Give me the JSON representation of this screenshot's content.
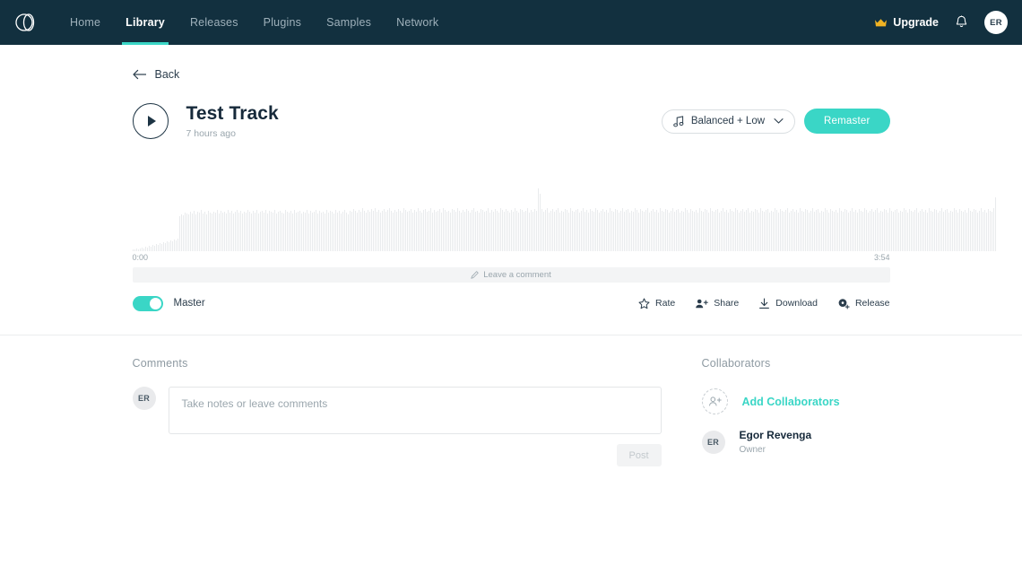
{
  "navbar": {
    "logo_icon": "overlapping-circles-logo",
    "items": [
      {
        "label": "Home",
        "active": false
      },
      {
        "label": "Library",
        "active": true
      },
      {
        "label": "Releases",
        "active": false
      },
      {
        "label": "Plugins",
        "active": false
      },
      {
        "label": "Samples",
        "active": false
      },
      {
        "label": "Network",
        "active": false
      }
    ],
    "upgrade_label": "Upgrade",
    "upgrade_icon": "crown-icon",
    "notification_icon": "bell-icon",
    "avatar_initials": "ER",
    "bg_color": "#12303f",
    "accent_color": "#3ad6c6",
    "crown_color": "#f0b323"
  },
  "page": {
    "back_label": "Back",
    "back_icon": "arrow-left-icon"
  },
  "track": {
    "play_icon": "play-icon",
    "title": "Test Track",
    "subtitle": "7 hours ago",
    "preset_label": "Balanced + Low",
    "preset_icon": "music-note-icon",
    "preset_chevron": "chevron-down-icon",
    "remaster_label": "Remaster",
    "remaster_color": "#3ad6c6"
  },
  "waveform": {
    "start_time": "0:00",
    "end_time": "3:54",
    "bar_color": "#e9ebed",
    "comment_hint": "Leave a comment",
    "comment_hint_icon": "pencil-icon",
    "amplitudes": [
      2,
      2,
      3,
      2,
      3,
      4,
      3,
      5,
      4,
      6,
      5,
      7,
      6,
      8,
      7,
      9,
      8,
      10,
      9,
      11,
      10,
      12,
      11,
      13,
      12,
      14,
      38,
      40,
      39,
      42,
      41,
      40,
      43,
      41,
      44,
      40,
      43,
      42,
      45,
      41,
      43,
      40,
      44,
      42,
      41,
      43,
      42,
      45,
      41,
      44,
      42,
      43,
      41,
      45,
      42,
      44,
      41,
      43,
      45,
      42,
      44,
      41,
      43,
      42,
      45,
      43,
      41,
      44,
      42,
      45,
      41,
      43,
      44,
      42,
      45,
      41,
      44,
      43,
      42,
      45,
      41,
      43,
      44,
      42,
      41,
      45,
      43,
      42,
      44,
      41,
      45,
      42,
      43,
      44,
      41,
      43,
      42,
      45,
      41,
      44,
      42,
      43,
      45,
      41,
      44,
      42,
      43,
      41,
      45,
      42,
      44,
      43,
      41,
      45,
      42,
      44,
      41,
      43,
      45,
      42,
      40,
      44,
      43,
      46,
      44,
      42,
      45,
      43,
      47,
      44,
      42,
      45,
      43,
      46,
      44,
      47,
      43,
      45,
      42,
      44,
      46,
      43,
      45,
      47,
      44,
      42,
      45,
      43,
      46,
      44,
      42,
      47,
      45,
      43,
      44,
      46,
      42,
      45,
      43,
      47,
      44,
      42,
      45,
      46,
      43,
      44,
      47,
      42,
      45,
      43,
      44,
      46,
      42,
      47,
      45,
      43,
      44,
      42,
      46,
      45,
      43,
      47,
      44,
      42,
      45,
      43,
      46,
      44,
      42,
      45,
      47,
      43,
      44,
      42,
      46,
      45,
      43,
      44,
      47,
      42,
      45,
      43,
      46,
      44,
      42,
      47,
      45,
      43,
      46,
      44,
      42,
      45,
      43,
      47,
      44,
      42,
      46,
      45,
      43,
      44,
      47,
      42,
      45,
      43,
      46,
      44,
      68,
      62,
      46,
      43,
      45,
      47,
      42,
      44,
      46,
      43,
      45,
      47,
      42,
      44,
      43,
      46,
      45,
      42,
      47,
      44,
      43,
      45,
      46,
      42,
      44,
      47,
      43,
      45,
      42,
      46,
      44,
      43,
      47,
      45,
      42,
      44,
      46,
      43,
      45,
      42,
      47,
      44,
      43,
      46,
      45,
      42,
      44,
      47,
      43,
      45,
      46,
      42,
      44,
      43,
      47,
      45,
      42,
      46,
      44,
      43,
      45,
      47,
      42,
      44,
      46,
      43,
      45,
      42,
      47,
      44,
      43,
      46,
      45,
      42,
      44,
      47,
      43,
      45,
      46,
      42,
      44,
      43,
      47,
      45,
      42,
      46,
      44,
      43,
      45,
      42,
      47,
      44,
      43,
      46,
      45,
      42,
      47,
      44,
      43,
      45,
      46,
      42,
      44,
      47,
      43,
      45,
      42,
      46,
      44,
      43,
      47,
      45,
      42,
      44,
      46,
      43,
      45,
      47,
      42,
      44,
      43,
      46,
      45,
      42,
      47,
      44,
      43,
      45,
      46,
      42,
      44,
      43,
      47,
      45,
      42,
      46,
      44,
      43,
      45,
      47,
      42,
      44,
      46,
      43,
      45,
      42,
      47,
      44,
      43,
      46,
      45,
      42,
      44,
      47,
      43,
      45,
      46,
      42,
      44,
      43,
      47,
      45,
      42,
      46,
      44,
      43,
      45,
      42,
      47,
      44,
      43,
      46,
      45,
      42,
      44,
      47,
      43,
      45,
      42,
      46,
      44,
      43,
      47,
      45,
      42,
      44,
      46,
      43,
      45,
      47,
      42,
      44,
      43,
      46,
      45,
      42,
      47,
      44,
      43,
      45,
      46,
      42,
      44,
      43,
      47,
      45,
      42,
      46,
      44,
      43,
      45,
      47,
      42,
      44,
      46,
      43,
      45,
      42,
      47,
      44,
      43,
      46,
      45,
      42,
      44,
      47,
      43,
      45,
      46,
      42,
      44,
      43,
      47,
      45,
      42,
      46,
      44,
      43,
      45,
      42,
      47,
      44,
      43,
      46,
      45,
      42,
      44,
      47,
      43,
      45,
      42,
      46,
      44,
      43,
      47,
      58
    ]
  },
  "track_controls": {
    "toggle_on": true,
    "toggle_label": "Master",
    "toggle_color": "#3ad6c6",
    "actions": [
      {
        "label": "Rate",
        "icon": "star-icon"
      },
      {
        "label": "Share",
        "icon": "share-people-icon"
      },
      {
        "label": "Download",
        "icon": "download-icon"
      },
      {
        "label": "Release",
        "icon": "disc-plus-icon"
      }
    ]
  },
  "comments": {
    "title": "Comments",
    "avatar_initials": "ER",
    "placeholder": "Take notes or leave comments",
    "value": "",
    "post_label": "Post"
  },
  "collaborators": {
    "title": "Collaborators",
    "add_label": "Add Collaborators",
    "add_icon": "person-plus-icon",
    "add_color": "#3ad6c6",
    "people": [
      {
        "initials": "ER",
        "name": "Egor Revenga",
        "role": "Owner"
      }
    ]
  }
}
